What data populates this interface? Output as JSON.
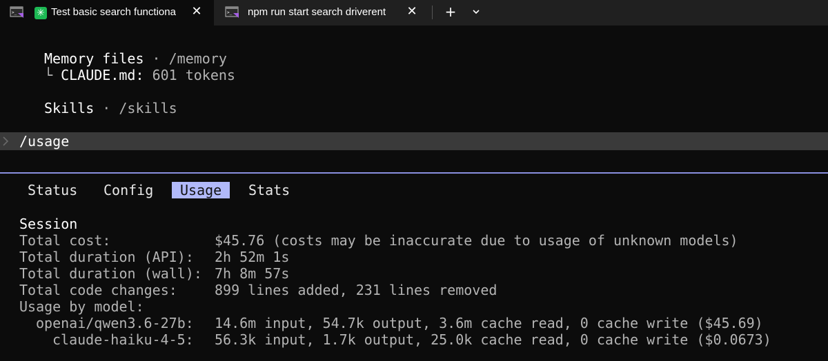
{
  "window": {
    "tabs": [
      {
        "title": "Test basic search functiona",
        "active": true,
        "icon": "terminal-icon",
        "badge_icon": "spark-icon",
        "close_icon": "close-icon"
      },
      {
        "title": "npm run start search driverent",
        "active": false,
        "icon": "terminal-icon",
        "close_icon": "close-icon"
      }
    ],
    "new_tab_glyph": "+",
    "accent_color": "#b1b9f9"
  },
  "context": {
    "memory_label": "Memory files",
    "memory_separator": "·",
    "memory_command": "/memory",
    "memory_tree_glyph": "└",
    "memory_file": "CLAUDE.md:",
    "memory_tokens": "601 tokens",
    "skills_label": "Skills",
    "skills_separator": "·",
    "skills_command": "/skills"
  },
  "prompt": {
    "command": "/usage"
  },
  "menu": {
    "tabs": [
      "Status",
      "Config",
      "Usage",
      "Stats"
    ],
    "selected": "Usage"
  },
  "session": {
    "heading": "Session",
    "rows": [
      {
        "label": "Total cost:",
        "value": "$45.76 (costs may be inaccurate due to usage of unknown models)"
      },
      {
        "label": "Total duration (API):",
        "value": "2h 52m 1s"
      },
      {
        "label": "Total duration (wall):",
        "value": "7h 8m 57s"
      },
      {
        "label": "Total code changes:",
        "value": "899 lines added, 231 lines removed"
      }
    ],
    "usage_by_model_label": "Usage by model:",
    "models": [
      {
        "name": "openai/qwen3.6-27b:",
        "value": "14.6m input, 54.7k output, 3.6m cache read, 0 cache write ($45.69)"
      },
      {
        "name": "claude-haiku-4-5:",
        "value": "56.3k input, 1.7k output, 25.0k cache read, 0 cache write ($0.0673)"
      }
    ]
  }
}
